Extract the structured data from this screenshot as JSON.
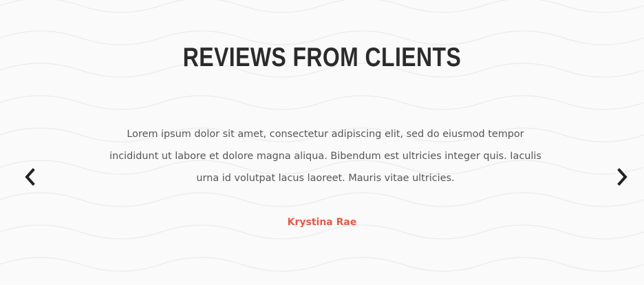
{
  "testimonials": {
    "heading": "REVIEWS FROM CLIENTS",
    "quote": "Lorem ipsum dolor sit amet, consectetur adipiscing elit, sed do eiusmod tempor incididunt ut labore et dolore magna aliqua. Bibendum est ultricies integer quis. Iaculis urna id volutpat lacus laoreet. Mauris vitae ultricies.",
    "author": "Krystina Rae",
    "prev_icon": "chevron-left-icon",
    "next_icon": "chevron-right-icon"
  },
  "colors": {
    "background": "#fafafa",
    "heading": "#2b2b2b",
    "body_text": "#555555",
    "author_accent": "#e35a48",
    "arrow": "#222222"
  }
}
